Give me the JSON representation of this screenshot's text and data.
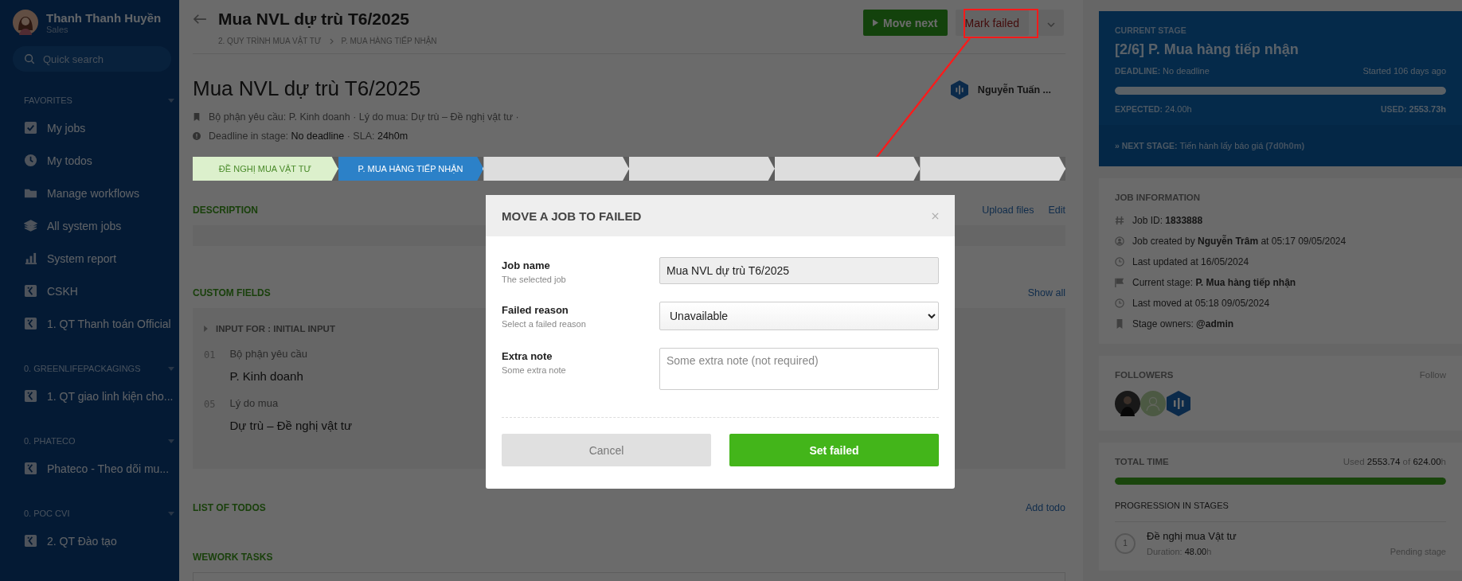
{
  "sidebar": {
    "user": {
      "name": "Thanh Thanh Huyền",
      "role": "Sales"
    },
    "search": {
      "placeholder": "Quick search"
    },
    "sections": [
      {
        "title": "FAVORITES",
        "items": [
          {
            "label": "My jobs",
            "kind": "check"
          },
          {
            "label": "My todos",
            "kind": "clock"
          },
          {
            "label": "Manage workflows",
            "kind": "folder"
          },
          {
            "label": "All system jobs",
            "kind": "layers"
          },
          {
            "label": "System report",
            "kind": "chart"
          },
          {
            "label": "CSKH",
            "kind": "workflow"
          },
          {
            "label": "1. QT Thanh toán Official",
            "kind": "workflow"
          }
        ]
      },
      {
        "title": "0. GREENLIFEPACKAGINGS",
        "items": [
          {
            "label": "1. QT giao linh kiện cho...",
            "kind": "workflow"
          }
        ]
      },
      {
        "title": "0. PHATECO",
        "items": [
          {
            "label": "Phateco - Theo dõi mu...",
            "kind": "workflow"
          }
        ]
      },
      {
        "title": "0. POC CVI",
        "items": [
          {
            "label": "2. QT Đào tạo",
            "kind": "workflow"
          }
        ]
      }
    ]
  },
  "header": {
    "title": "Mua NVL dự trù T6/2025",
    "breadcrumb": [
      "2. QUY TRÌNH MUA VẬT TƯ",
      "P. MUA HÀNG TIẾP NHẬN"
    ],
    "move_next": "Move next",
    "mark_failed": "Mark failed",
    "highlighted": true
  },
  "job": {
    "title": "Mua NVL dự trù T6/2025",
    "assignee": "Nguyễn Tuấn ...",
    "meta": [
      {
        "kind": "bookmark",
        "text": "Bộ phận yêu cầu: P. Kinh doanh · Lý do mua: Dự trù – Đề nghị vật tư ·"
      },
      {
        "kind": "alert",
        "label": "Deadline in stage:",
        "value": "No deadline",
        "sep": "· SLA:",
        "value2": "24h0m"
      }
    ],
    "stages": [
      {
        "label": "ĐỀ NGHỊ MUA VẬT TƯ",
        "completed": true,
        "selected": false
      },
      {
        "label": "P. MUA HÀNG TIẾP NHẬN",
        "completed": false,
        "selected": true
      },
      {
        "completed": false,
        "selected": false
      },
      {
        "completed": false,
        "selected": false
      },
      {
        "completed": false,
        "selected": false
      },
      {
        "completed": false,
        "selected": false
      }
    ]
  },
  "description": {
    "title": "DESCRIPTION",
    "actions": [
      "Upload files",
      "Edit"
    ]
  },
  "custom_fields": {
    "title": "CUSTOM FIELDS",
    "action": "Show all",
    "group": "INPUT FOR : INITIAL INPUT",
    "fields": [
      {
        "number": "01",
        "label": "Bộ phận yêu cầu",
        "value": "P. Kinh doanh"
      },
      {
        "number": "05",
        "label": "Lý do mua",
        "value": "Dự trù – Đề nghị vật tư"
      }
    ]
  },
  "todos": {
    "title": "LIST OF TODOS",
    "action": "Add todo"
  },
  "wework": {
    "title": "WEWORK TASKS"
  },
  "current_stage": {
    "label": "CURRENT STAGE",
    "title": "[2/6] P. Mua hàng tiếp nhận",
    "deadline_label": "DEADLINE:",
    "deadline": "No deadline",
    "started": "Started 106 days ago",
    "level": 1,
    "expected_label": "EXPECTED:",
    "expected": "24.00h",
    "used_label": "USED:",
    "used": "2553.73h",
    "next_label": "» NEXT STAGE:",
    "next": "Tiến hành lấy báo giá",
    "next_time": "(7d0h0m)"
  },
  "job_information": {
    "title": "JOB INFORMATION",
    "rows": [
      {
        "kind": "hash",
        "text": "Job ID: **1833888**"
      },
      {
        "kind": "user",
        "text": "Job created by **Nguyễn Trâm** at 05:17 09/05/2024"
      },
      {
        "kind": "clock",
        "text": "Last updated at 16/05/2024"
      },
      {
        "kind": "flag",
        "text": "Current stage: **P. Mua hàng tiếp nhận**"
      },
      {
        "kind": "clock",
        "text": "Last moved at 05:18 09/05/2024"
      },
      {
        "kind": "bookmark",
        "text": "Stage owners: **@admin**"
      }
    ]
  },
  "followers": {
    "title": "FOLLOWERS",
    "action": "Follow",
    "people": [
      {
        "kind": "photo"
      },
      {
        "kind": "placeholder"
      },
      {
        "kind": "logo"
      }
    ]
  },
  "total_time": {
    "title": "TOTAL TIME",
    "used_label": "Used",
    "used": "2553.74",
    "of": "of",
    "total": "624.00",
    "unit": "h",
    "level": 1,
    "progression_title": "PROGRESSION IN STAGES",
    "stages": [
      {
        "number": "1",
        "name": "Đề nghị mua Vật tư",
        "duration_label": "Duration:",
        "duration": "48.00",
        "unit": "h",
        "status": "Pending stage"
      }
    ]
  },
  "modal": {
    "title": "MOVE A JOB TO FAILED",
    "fields": [
      {
        "kind": "input",
        "label": "Job name",
        "hint": "The selected job",
        "value": "Mua NVL dự trù T6/2025"
      },
      {
        "kind": "select",
        "label": "Failed reason",
        "hint": "Select a failed reason",
        "value": "Unavailable"
      },
      {
        "kind": "textarea",
        "label": "Extra note",
        "hint": "Some extra note",
        "placeholder": "Some extra note (not required)"
      }
    ],
    "cancel": "Cancel",
    "confirm": "Set failed"
  }
}
